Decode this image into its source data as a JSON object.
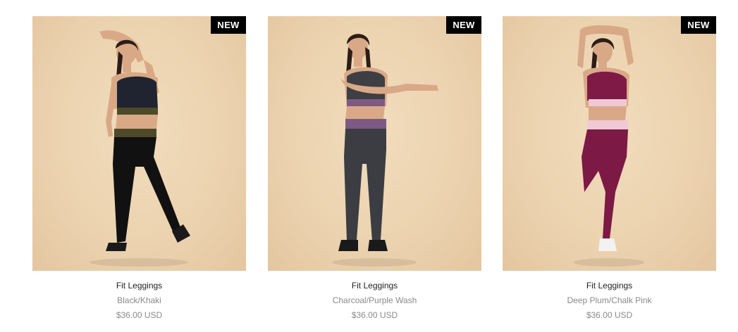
{
  "products": [
    {
      "badge": "NEW",
      "name": "Fit Leggings",
      "variant": "Black/Khaki",
      "price": "$36.00 USD",
      "colors": {
        "top": "#1f2430",
        "band": "#4d4a2a",
        "legging": "#111111",
        "shoe": "#1a1a1a",
        "skin": "#d9a987",
        "hair": "#2b1d16"
      }
    },
    {
      "badge": "NEW",
      "name": "Fit Leggings",
      "variant": "Charcoal/Purple Wash",
      "price": "$36.00 USD",
      "colors": {
        "top": "#3d3f44",
        "band": "#7d5a86",
        "legging": "#3b3d42",
        "shoe": "#1a1a1a",
        "skin": "#d9a987",
        "hair": "#2b1d16"
      }
    },
    {
      "badge": "NEW",
      "name": "Fit Leggings",
      "variant": "Deep Plum/Chalk Pink",
      "price": "$36.00 USD",
      "colors": {
        "top": "#7e1a45",
        "band": "#f0c9d4",
        "legging": "#7c1944",
        "shoe": "#f2f2f2",
        "skin": "#d9a987",
        "hair": "#2b1d16"
      }
    }
  ]
}
